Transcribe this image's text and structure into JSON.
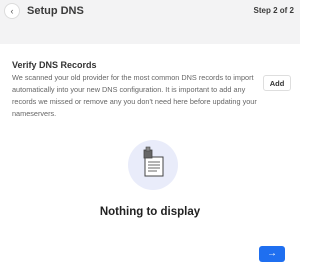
{
  "header": {
    "title": "Setup DNS",
    "step": "Step 2 of 2",
    "back_icon": "chevron-left-icon"
  },
  "section": {
    "title": "Verify DNS Records",
    "description": "We scanned your old provider for the most common DNS records to import automatically into your new DNS configuration. It is important to add any records we missed or remove any you don't need here before updating your nameservers.",
    "add_label": "Add"
  },
  "empty_state": {
    "icon": "document-with-stamp-icon",
    "text": "Nothing to display"
  },
  "next_button": {
    "icon": "arrow-right-icon"
  },
  "colors": {
    "accent": "#1f6ff0",
    "background": "#f3f3f4",
    "illustration_bg": "#e9ecfa"
  }
}
